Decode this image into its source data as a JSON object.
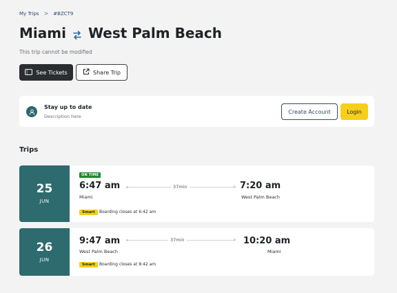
{
  "breadcrumb": {
    "root": "My Trips",
    "separator": ">",
    "current": "#BZCT9"
  },
  "header": {
    "from": "Miami",
    "to": "West Palm Beach",
    "note": "This trip cannot be modified"
  },
  "actions": {
    "see_tickets": "See Tickets",
    "share_trip": "Share Trip"
  },
  "banner": {
    "title": "Stay up to date",
    "description": "Description here",
    "create_account": "Create Account",
    "login": "Login"
  },
  "trips_section": {
    "title": "Trips"
  },
  "trips": [
    {
      "day": "25",
      "month": "JUN",
      "status": "ON TIME",
      "depart_time": "6:47 am",
      "depart_city": "Miami",
      "duration": "37min",
      "arrive_time": "7:20 am",
      "arrive_city": "West Palm Beach",
      "badge": "Smart",
      "boarding": "Boarding closes at 6:42 am"
    },
    {
      "day": "26",
      "month": "JUN",
      "status": "",
      "depart_time": "9:47 am",
      "depart_city": "West Palm Beach",
      "duration": "37min",
      "arrive_time": "10:20 am",
      "arrive_city": "Miami",
      "badge": "Smart",
      "boarding": "Boarding closes at 8:42 am"
    }
  ],
  "colors": {
    "accent_teal": "#2d6b6f",
    "accent_yellow": "#f6cf1a",
    "status_green": "#1e8a2e",
    "link_blue": "#2c4a6b"
  },
  "icons": {
    "swap": "swap-arrows-icon",
    "ticket": "ticket-icon",
    "share": "external-link-icon",
    "avatar": "user-icon"
  }
}
